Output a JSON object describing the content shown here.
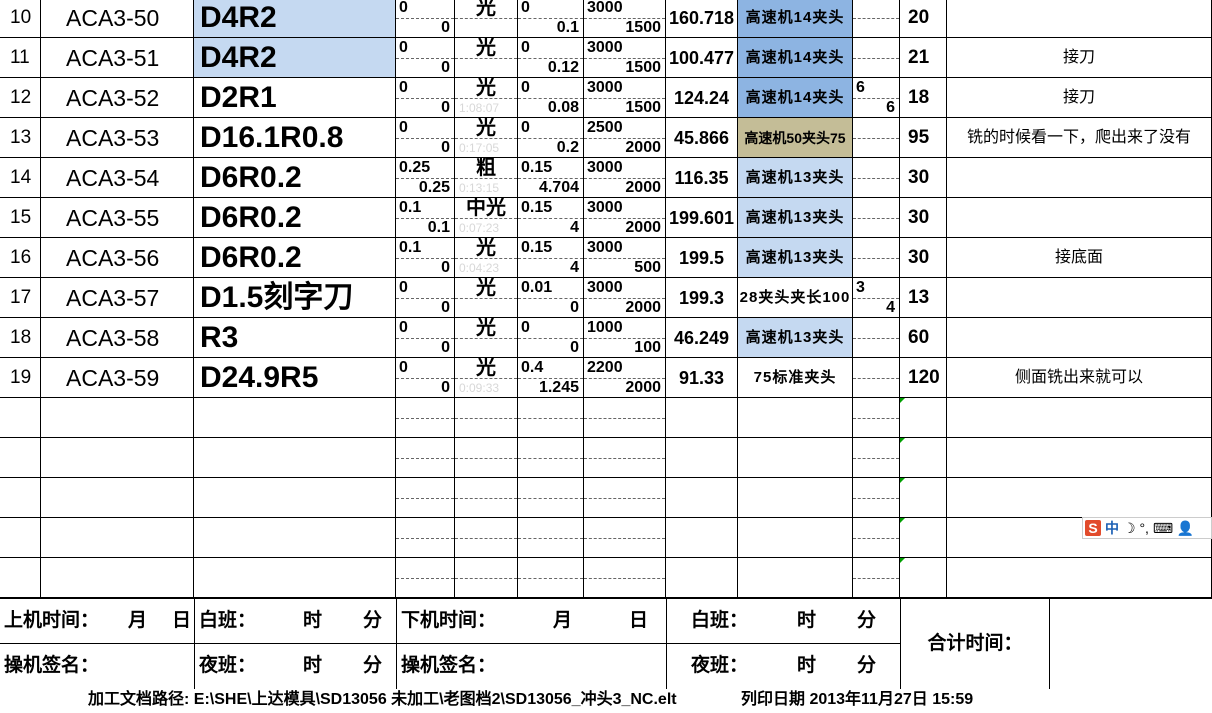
{
  "rows": [
    {
      "idx": "10",
      "code": "ACA3-50",
      "tool": "D4R2",
      "tool_hl": true,
      "a1": "0",
      "a2": "0",
      "b1": "光",
      "b2": "",
      "c1": "0",
      "c2": "0.1",
      "d1": "3000",
      "d2": "1500",
      "len": "160.718",
      "holder": "高速机14夹头",
      "holder_style": "dblue",
      "e1": "",
      "e2": "",
      "min": "20",
      "note": ""
    },
    {
      "idx": "11",
      "code": "ACA3-51",
      "tool": "D4R2",
      "tool_hl": true,
      "a1": "0",
      "a2": "0",
      "b1": "光",
      "b2": "",
      "c1": "0",
      "c2": "0.12",
      "d1": "3000",
      "d2": "1500",
      "len": "100.477",
      "holder": "高速机14夹头",
      "holder_style": "dblue",
      "e1": "",
      "e2": "",
      "min": "21",
      "note": "接刀"
    },
    {
      "idx": "12",
      "code": "ACA3-52",
      "tool": "D2R1",
      "tool_hl": false,
      "a1": "0",
      "a2": "0",
      "b1": "光",
      "b2": "1:08:07",
      "c1": "0",
      "c2": "0.08",
      "d1": "3000",
      "d2": "1500",
      "len": "124.24",
      "holder": "高速机14夹头",
      "holder_style": "dblue",
      "e1": "6",
      "e2": "6",
      "min": "18",
      "note": "接刀"
    },
    {
      "idx": "13",
      "code": "ACA3-53",
      "tool": "D16.1R0.8",
      "tool_hl": false,
      "a1": "0",
      "a2": "0",
      "b1": "光",
      "b2": "0:17:05",
      "c1": "0",
      "c2": "0.2",
      "d1": "2500",
      "d2": "2000",
      "len": "45.866",
      "holder": "高速机50夹头75",
      "holder_style": "tan",
      "e1": "",
      "e2": "",
      "min": "95",
      "note": "铣的时候看一下，爬出来了没有"
    },
    {
      "idx": "14",
      "code": "ACA3-54",
      "tool": "D6R0.2",
      "tool_hl": false,
      "a1": "0.25",
      "a2": "0.25",
      "b1": "粗",
      "b2": "0:13:15",
      "c1": "0.15",
      "c2": "4.704",
      "d1": "3000",
      "d2": "2000",
      "len": "116.35",
      "holder": "高速机13夹头",
      "holder_style": "blue",
      "e1": "",
      "e2": "",
      "min": "30",
      "note": ""
    },
    {
      "idx": "15",
      "code": "ACA3-55",
      "tool": "D6R0.2",
      "tool_hl": false,
      "a1": "0.1",
      "a2": "0.1",
      "b1": "中光",
      "b2": "0:07:23",
      "c1": "0.15",
      "c2": "4",
      "d1": "3000",
      "d2": "2000",
      "len": "199.601",
      "holder": "高速机13夹头",
      "holder_style": "blue",
      "e1": "",
      "e2": "",
      "min": "30",
      "note": ""
    },
    {
      "idx": "16",
      "code": "ACA3-56",
      "tool": "D6R0.2",
      "tool_hl": false,
      "a1": "0.1",
      "a2": "0",
      "b1": "光",
      "b2": "0:04:23",
      "c1": "0.15",
      "c2": "4",
      "d1": "3000",
      "d2": "500",
      "len": "199.5",
      "holder": "高速机13夹头",
      "holder_style": "blue",
      "e1": "",
      "e2": "",
      "min": "30",
      "note": "接底面"
    },
    {
      "idx": "17",
      "code": "ACA3-57",
      "tool": "D1.5刻字刀",
      "tool_hl": false,
      "a1": "0",
      "a2": "0",
      "b1": "光",
      "b2": "",
      "c1": "0.01",
      "c2": "0",
      "d1": "3000",
      "d2": "2000",
      "len": "199.3",
      "holder": "28夹头夹长100",
      "holder_style": "none",
      "e1": "3",
      "e2": "4",
      "min": "13",
      "note": ""
    },
    {
      "idx": "18",
      "code": "ACA3-58",
      "tool": "R3",
      "tool_hl": false,
      "a1": "0",
      "a2": "0",
      "b1": "光",
      "b2": "",
      "c1": "0",
      "c2": "0",
      "d1": "1000",
      "d2": "100",
      "len": "46.249",
      "holder": "高速机13夹头",
      "holder_style": "blue",
      "e1": "",
      "e2": "",
      "min": "60",
      "note": ""
    },
    {
      "idx": "19",
      "code": "ACA3-59",
      "tool": "D24.9R5",
      "tool_hl": false,
      "a1": "0",
      "a2": "0",
      "b1": "光",
      "b2": "0:09:33",
      "c1": "0.4",
      "c2": "1.245",
      "d1": "2200",
      "d2": "2000",
      "len": "91.33",
      "holder": "75标准夹头",
      "holder_style": "none",
      "e1": "",
      "e2": "",
      "min": "120",
      "note": "侧面铣出来就可以"
    }
  ],
  "empty_rows": 5,
  "footer": {
    "start_label": "上机时间：",
    "month": "月",
    "day": "日",
    "day_shift": "白班：",
    "hour": "时",
    "minute": "分",
    "end_label": "下机时间：",
    "sign_label": "操机签名：",
    "night_shift": "夜班：",
    "total_label": "合计时间："
  },
  "path_text": "加工文档路径: E:\\SHE\\上达模具\\SD13056  未加工\\老图档2\\SD13056_冲头3_NC.elt",
  "print_text": "列印日期  2013年11月27日  15:59",
  "ime": {
    "s": "S",
    "lang": "中",
    "icons": "☽ °, ⌨ 👤"
  },
  "colors": {
    "light_blue": "#c5d9f1",
    "blue": "#8db4e2",
    "tan": "#c4bd97"
  }
}
